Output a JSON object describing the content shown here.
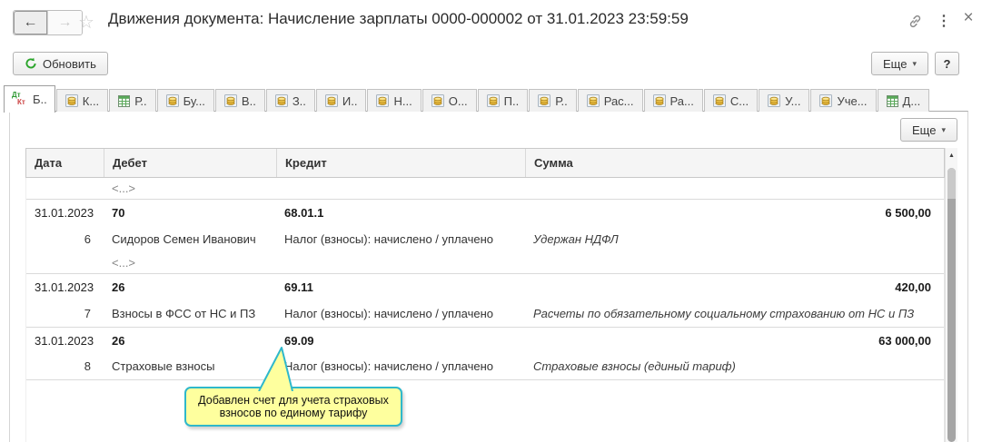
{
  "window": {
    "title": "Движения документа: Начисление зарплаты 0000-000002 от 31.01.2023 23:59:59",
    "menu_glyph": "⋮",
    "close_glyph": "×"
  },
  "nav": {
    "back_glyph": "←",
    "forward_glyph": "→",
    "favorite_glyph": "☆"
  },
  "toolbar": {
    "refresh": "Обновить",
    "more": "Еще",
    "more_caret": "▾",
    "help": "?"
  },
  "tabs": [
    {
      "label": "Б..",
      "icon": "dtkt",
      "active": true
    },
    {
      "label": "К...",
      "icon": "coins",
      "active": false
    },
    {
      "label": "Р..",
      "icon": "grid",
      "active": false
    },
    {
      "label": "Бу...",
      "icon": "coins",
      "active": false
    },
    {
      "label": "В..",
      "icon": "coins",
      "active": false
    },
    {
      "label": "З..",
      "icon": "coins",
      "active": false
    },
    {
      "label": "И..",
      "icon": "coins",
      "active": false
    },
    {
      "label": "Н...",
      "icon": "coins",
      "active": false
    },
    {
      "label": "О...",
      "icon": "coins",
      "active": false
    },
    {
      "label": "П..",
      "icon": "coins",
      "active": false
    },
    {
      "label": "Р..",
      "icon": "coins",
      "active": false
    },
    {
      "label": "Рас...",
      "icon": "coins",
      "active": false
    },
    {
      "label": "Ра...",
      "icon": "coins",
      "active": false
    },
    {
      "label": "С...",
      "icon": "coins",
      "active": false
    },
    {
      "label": "У...",
      "icon": "coins",
      "active": false
    },
    {
      "label": "Уче...",
      "icon": "coins",
      "active": false
    },
    {
      "label": "Д...",
      "icon": "grid",
      "active": false
    }
  ],
  "panel": {
    "more": "Еще",
    "more_caret": "▾"
  },
  "table": {
    "columns": [
      "Дата",
      "Дебет",
      "Кредит",
      "Сумма"
    ],
    "rows": [
      {
        "type": "ellipsis",
        "debit": "<...>"
      },
      {
        "type": "main",
        "date": "31.01.2023",
        "debit": "70",
        "credit": "68.01.1",
        "sum": "6 500,00"
      },
      {
        "type": "detail",
        "num": "6",
        "debit": "Сидоров Семен Иванович",
        "credit": "Налог (взносы): начислено / уплачено",
        "comment": "Удержан НДФЛ"
      },
      {
        "type": "ellipsis",
        "debit": "<...>"
      },
      {
        "type": "main",
        "date": "31.01.2023",
        "debit": "26",
        "credit": "69.11",
        "sum": "420,00"
      },
      {
        "type": "detail",
        "num": "7",
        "debit": "Взносы в ФСС от НС и ПЗ",
        "credit": "Налог (взносы): начислено / уплачено",
        "comment": "Расчеты по обязательному социальному страхованию от НС и ПЗ"
      },
      {
        "type": "main",
        "date": "31.01.2023",
        "debit": "26",
        "credit": "69.09",
        "sum": "63 000,00"
      },
      {
        "type": "detail",
        "num": "8",
        "debit": "Страховые взносы",
        "credit": "Налог (взносы): начислено / уплачено",
        "comment": "Страховые взносы (единый тариф)"
      }
    ]
  },
  "callout": {
    "text": "Добавлен счет для учета страховых взносов по единому тарифу",
    "bg": "#feff9e",
    "border": "#2fb8cb"
  },
  "colors": {
    "refresh_green": "#2ca52c",
    "dt_green": "#2e9932",
    "kt_red": "#cc4444",
    "callout_bg": "#feff9e",
    "callout_border": "#2fb8cb"
  }
}
